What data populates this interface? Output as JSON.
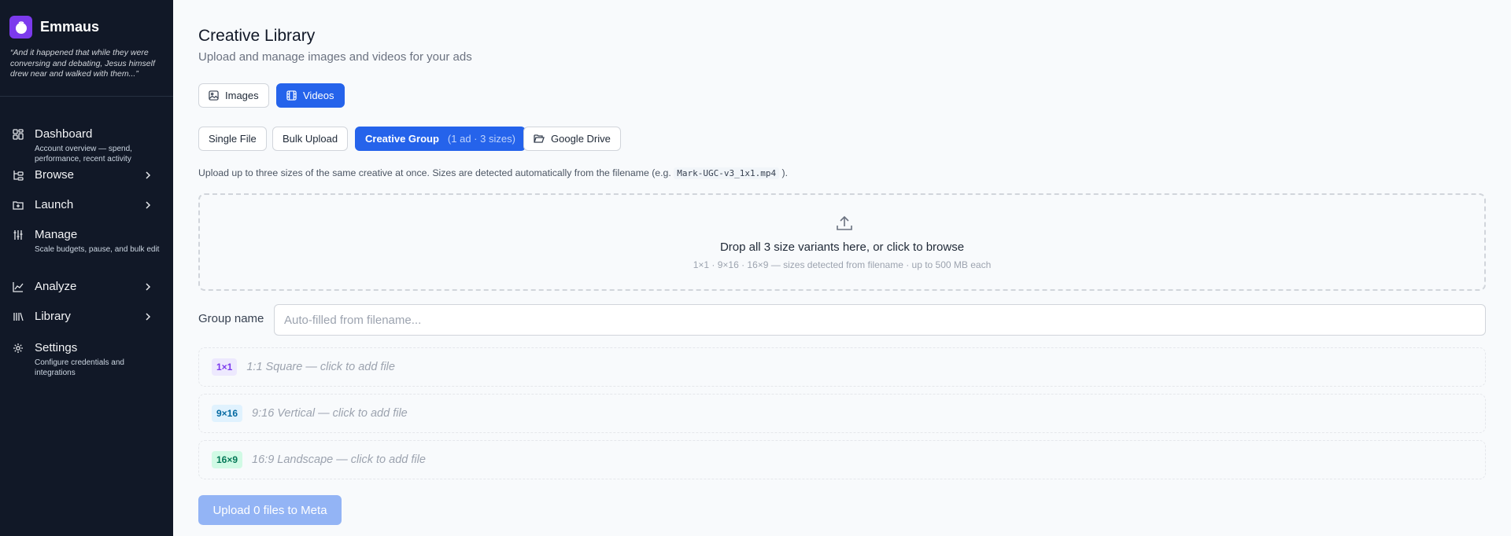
{
  "app": {
    "name": "Emmaus",
    "quote": "“And it happened that while they were conversing and debating, Jesus himself drew near and walked with them...”"
  },
  "sidebar": {
    "items": [
      {
        "label": "Dashboard",
        "description": "Account overview — spend, performance, recent activity",
        "icon": "grid-icon",
        "has_chevron": false
      },
      {
        "label": "Browse",
        "description": "",
        "icon": "tree-icon",
        "has_chevron": true
      },
      {
        "label": "Launch",
        "description": "",
        "icon": "folder-plus-icon",
        "has_chevron": true
      },
      {
        "label": "Manage",
        "description": "Scale budgets, pause, and bulk edit",
        "icon": "sliders-icon",
        "has_chevron": false
      },
      {
        "label": "Analyze",
        "description": "",
        "icon": "chart-line-icon",
        "has_chevron": true
      },
      {
        "label": "Library",
        "description": "",
        "icon": "library-icon",
        "has_chevron": true
      },
      {
        "label": "Settings",
        "description": "Configure credentials and integrations",
        "icon": "gear-icon",
        "has_chevron": false
      }
    ]
  },
  "main": {
    "title": "Creative Library",
    "subtitle": "Upload and manage images and videos for your ads",
    "media_tabs": [
      {
        "label": "Images",
        "active": false
      },
      {
        "label": "Videos",
        "active": true
      }
    ],
    "upload_modes": [
      {
        "label": "Single File",
        "active": false
      },
      {
        "label": "Bulk Upload",
        "active": false
      },
      {
        "label": "Creative Group",
        "detail": "(1 ad · 3 sizes)",
        "active": true
      },
      {
        "label": "Google Drive",
        "active": false
      }
    ],
    "helper_prefix": "Upload up to three sizes of the same creative at once. Sizes are detected automatically from the filename (e.g.",
    "helper_code": "Mark-UGC-v3_1x1.mp4",
    "helper_suffix": ").",
    "dropzone": {
      "title": "Drop all 3 size variants here, or click to browse",
      "subtitle": "1×1 · 9×16 · 16×9 — sizes detected from filename · up to 500 MB each"
    },
    "group_name": {
      "label": "Group name",
      "value": "",
      "placeholder": "Auto-filled from filename..."
    },
    "slots": [
      {
        "badge": "1×1",
        "text": "1:1 Square — click to add file",
        "badge_bg": "#ede9fe",
        "badge_fg": "#7c3aed"
      },
      {
        "badge": "9×16",
        "text": "9:16 Vertical — click to add file",
        "badge_bg": "#e0f2fe",
        "badge_fg": "#0369a1"
      },
      {
        "badge": "16×9",
        "text": "16:9 Landscape — click to add file",
        "badge_bg": "#d1fae5",
        "badge_fg": "#047857"
      }
    ],
    "upload_button": "Upload 0 files to Meta"
  },
  "colors": {
    "accent": "#2563eb",
    "sidebar_bg": "#111827",
    "logo_bg": "#7c3aed",
    "upload_disabled": "#93b4f5"
  }
}
